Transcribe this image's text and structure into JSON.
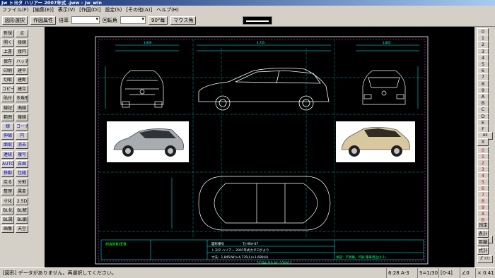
{
  "window": {
    "title": "Jw トヨタ ハリアー  2007年式 .jww  -  jw_win"
  },
  "menu": [
    "ファイル(F)",
    "[編集(E)]",
    "表示(V)",
    "[作図(D)]",
    "設定(S)",
    "[その他(A)]",
    "ヘルプ(H)"
  ],
  "toolbar": {
    "rect_select": "図形選択",
    "attr_select": "作図属性",
    "scale_label": "倍率",
    "rotate_label": "回転角",
    "rot90": "90°毎",
    "mouse_angle": "マウス角"
  },
  "left_tools": [
    "新規",
    "点",
    "開く",
    "接線",
    "上書",
    "接円",
    "保存",
    "ハッチ",
    "印刷",
    "建平",
    "切取",
    "建断",
    "コピー",
    "建立",
    "貼付",
    "多角形",
    "線記",
    "曲線",
    "範囲",
    "複線",
    "線",
    "コーナー",
    "伸縮",
    "円",
    "面取",
    "消去",
    "連続",
    "複写",
    "AUTO",
    "自由",
    "移動",
    "包絡",
    "戻る",
    "分割",
    "整理",
    "属変",
    "寸化",
    "2.5D",
    "BL化",
    "BL解",
    "BL属",
    "BL編",
    "画像",
    "天空"
  ],
  "right_tools": [
    "0",
    "1",
    "2",
    "3",
    "4",
    "5",
    "6",
    "7",
    "8",
    "9",
    "A",
    "B",
    "C",
    "D",
    "E",
    "F",
    "All",
    "X",
    "0",
    "1",
    "2",
    "3",
    "4",
    "5",
    "6",
    "7",
    "8",
    "9",
    "A",
    "B",
    "C",
    "D",
    "All",
    "X",
    "測定",
    "表計",
    "距離",
    "式計",
    "ｶﾞｿﾘﾝ"
  ],
  "drawing": {
    "dims_top": [
      "1,949",
      "4,735",
      "1,845"
    ],
    "title_label": "図形番号",
    "title_no": "TJ-HRA-07",
    "model_name": "トヨタ ハリアー 2007年式カタログより",
    "size_line": "寸法：1,845(W)×4,735(L)×1,680(H)",
    "logo": "HARRIER",
    "footer_note": "2014年 所在 地ー10000-Y",
    "stamp_note": "承認：不明確。印刷  電車用品(0-1)"
  },
  "statusbar": {
    "message": "[図形] データがありません。再選択してください。",
    "coords": "6:28  A-3",
    "scale": "S=1/30",
    "layer": "[0-4]",
    "angle": "∠0",
    "zoom": "× 0.41"
  }
}
